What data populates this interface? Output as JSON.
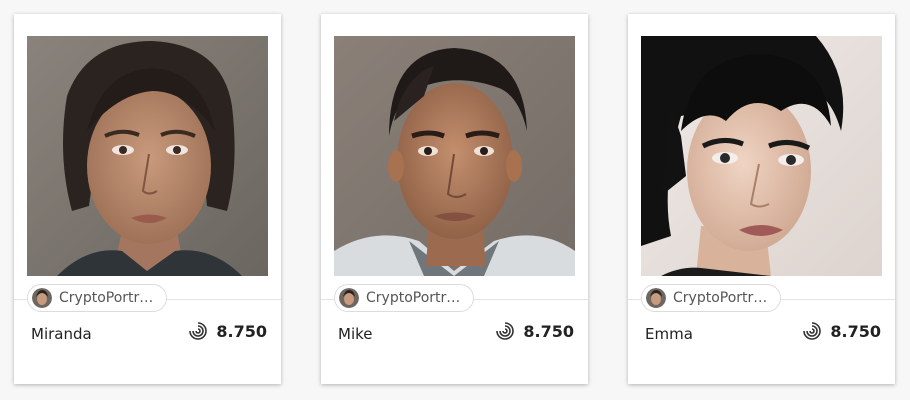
{
  "cards": [
    {
      "name": "Miranda",
      "creator": "CryptoPortr…",
      "price": "8.750",
      "portrait_icon": "woman-portrait",
      "currency_icon": "swirl-currency-icon"
    },
    {
      "name": "Mike",
      "creator": "CryptoPortr…",
      "price": "8.750",
      "portrait_icon": "man-portrait",
      "currency_icon": "swirl-currency-icon"
    },
    {
      "name": "Emma",
      "creator": "CryptoPortr…",
      "price": "8.750",
      "portrait_icon": "woman-short-hair-portrait",
      "currency_icon": "swirl-currency-icon"
    }
  ],
  "colors": {
    "card_bg": "#ffffff",
    "page_bg": "#f7f7f7",
    "text_primary": "#222222",
    "text_secondary": "#555555"
  }
}
